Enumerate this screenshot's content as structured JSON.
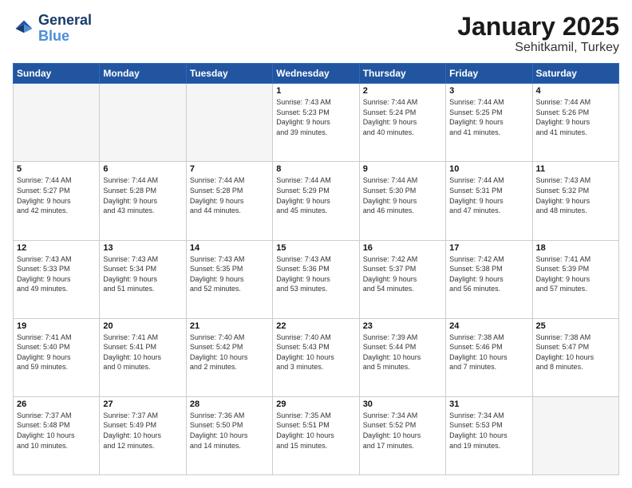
{
  "header": {
    "logo_line1": "General",
    "logo_line2": "Blue",
    "main_title": "January 2025",
    "subtitle": "Sehitkamil, Turkey"
  },
  "days_of_week": [
    "Sunday",
    "Monday",
    "Tuesday",
    "Wednesday",
    "Thursday",
    "Friday",
    "Saturday"
  ],
  "weeks": [
    [
      {
        "day": "",
        "info": ""
      },
      {
        "day": "",
        "info": ""
      },
      {
        "day": "",
        "info": ""
      },
      {
        "day": "1",
        "info": "Sunrise: 7:43 AM\nSunset: 5:23 PM\nDaylight: 9 hours\nand 39 minutes."
      },
      {
        "day": "2",
        "info": "Sunrise: 7:44 AM\nSunset: 5:24 PM\nDaylight: 9 hours\nand 40 minutes."
      },
      {
        "day": "3",
        "info": "Sunrise: 7:44 AM\nSunset: 5:25 PM\nDaylight: 9 hours\nand 41 minutes."
      },
      {
        "day": "4",
        "info": "Sunrise: 7:44 AM\nSunset: 5:26 PM\nDaylight: 9 hours\nand 41 minutes."
      }
    ],
    [
      {
        "day": "5",
        "info": "Sunrise: 7:44 AM\nSunset: 5:27 PM\nDaylight: 9 hours\nand 42 minutes."
      },
      {
        "day": "6",
        "info": "Sunrise: 7:44 AM\nSunset: 5:28 PM\nDaylight: 9 hours\nand 43 minutes."
      },
      {
        "day": "7",
        "info": "Sunrise: 7:44 AM\nSunset: 5:28 PM\nDaylight: 9 hours\nand 44 minutes."
      },
      {
        "day": "8",
        "info": "Sunrise: 7:44 AM\nSunset: 5:29 PM\nDaylight: 9 hours\nand 45 minutes."
      },
      {
        "day": "9",
        "info": "Sunrise: 7:44 AM\nSunset: 5:30 PM\nDaylight: 9 hours\nand 46 minutes."
      },
      {
        "day": "10",
        "info": "Sunrise: 7:44 AM\nSunset: 5:31 PM\nDaylight: 9 hours\nand 47 minutes."
      },
      {
        "day": "11",
        "info": "Sunrise: 7:43 AM\nSunset: 5:32 PM\nDaylight: 9 hours\nand 48 minutes."
      }
    ],
    [
      {
        "day": "12",
        "info": "Sunrise: 7:43 AM\nSunset: 5:33 PM\nDaylight: 9 hours\nand 49 minutes."
      },
      {
        "day": "13",
        "info": "Sunrise: 7:43 AM\nSunset: 5:34 PM\nDaylight: 9 hours\nand 51 minutes."
      },
      {
        "day": "14",
        "info": "Sunrise: 7:43 AM\nSunset: 5:35 PM\nDaylight: 9 hours\nand 52 minutes."
      },
      {
        "day": "15",
        "info": "Sunrise: 7:43 AM\nSunset: 5:36 PM\nDaylight: 9 hours\nand 53 minutes."
      },
      {
        "day": "16",
        "info": "Sunrise: 7:42 AM\nSunset: 5:37 PM\nDaylight: 9 hours\nand 54 minutes."
      },
      {
        "day": "17",
        "info": "Sunrise: 7:42 AM\nSunset: 5:38 PM\nDaylight: 9 hours\nand 56 minutes."
      },
      {
        "day": "18",
        "info": "Sunrise: 7:41 AM\nSunset: 5:39 PM\nDaylight: 9 hours\nand 57 minutes."
      }
    ],
    [
      {
        "day": "19",
        "info": "Sunrise: 7:41 AM\nSunset: 5:40 PM\nDaylight: 9 hours\nand 59 minutes."
      },
      {
        "day": "20",
        "info": "Sunrise: 7:41 AM\nSunset: 5:41 PM\nDaylight: 10 hours\nand 0 minutes."
      },
      {
        "day": "21",
        "info": "Sunrise: 7:40 AM\nSunset: 5:42 PM\nDaylight: 10 hours\nand 2 minutes."
      },
      {
        "day": "22",
        "info": "Sunrise: 7:40 AM\nSunset: 5:43 PM\nDaylight: 10 hours\nand 3 minutes."
      },
      {
        "day": "23",
        "info": "Sunrise: 7:39 AM\nSunset: 5:44 PM\nDaylight: 10 hours\nand 5 minutes."
      },
      {
        "day": "24",
        "info": "Sunrise: 7:38 AM\nSunset: 5:46 PM\nDaylight: 10 hours\nand 7 minutes."
      },
      {
        "day": "25",
        "info": "Sunrise: 7:38 AM\nSunset: 5:47 PM\nDaylight: 10 hours\nand 8 minutes."
      }
    ],
    [
      {
        "day": "26",
        "info": "Sunrise: 7:37 AM\nSunset: 5:48 PM\nDaylight: 10 hours\nand 10 minutes."
      },
      {
        "day": "27",
        "info": "Sunrise: 7:37 AM\nSunset: 5:49 PM\nDaylight: 10 hours\nand 12 minutes."
      },
      {
        "day": "28",
        "info": "Sunrise: 7:36 AM\nSunset: 5:50 PM\nDaylight: 10 hours\nand 14 minutes."
      },
      {
        "day": "29",
        "info": "Sunrise: 7:35 AM\nSunset: 5:51 PM\nDaylight: 10 hours\nand 15 minutes."
      },
      {
        "day": "30",
        "info": "Sunrise: 7:34 AM\nSunset: 5:52 PM\nDaylight: 10 hours\nand 17 minutes."
      },
      {
        "day": "31",
        "info": "Sunrise: 7:34 AM\nSunset: 5:53 PM\nDaylight: 10 hours\nand 19 minutes."
      },
      {
        "day": "",
        "info": ""
      }
    ]
  ]
}
